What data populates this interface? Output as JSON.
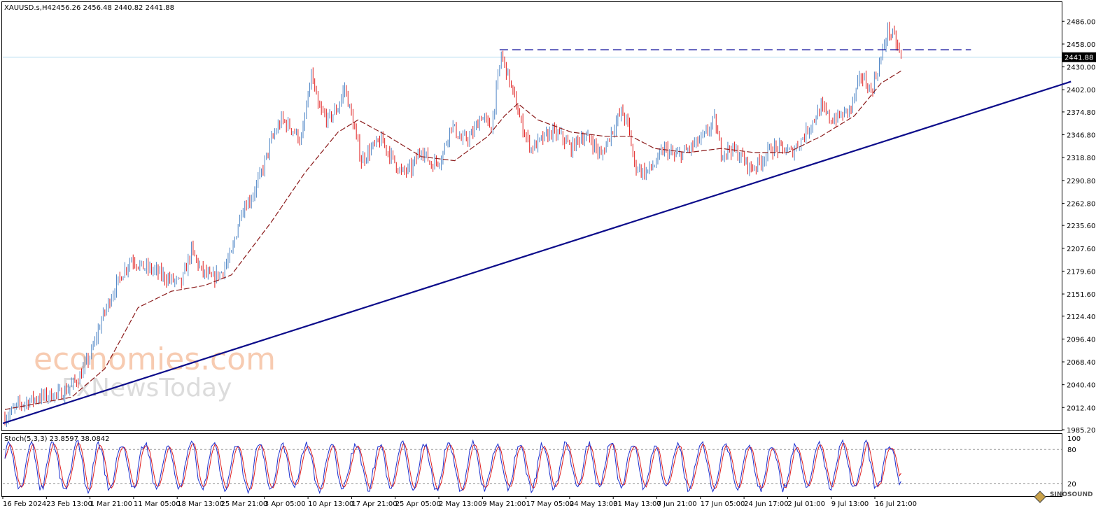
{
  "chart_data": {
    "type": "candlestick",
    "symbol_header": "XAUUSD.s,H4",
    "ohlc_header": "2456.26 2456.48 2440.82 2441.88",
    "ohlc": {
      "open": 2456.26,
      "high": 2456.48,
      "low": 2440.82,
      "close": 2441.88
    },
    "current_price_label": "2441.88",
    "current_price": 2441.88,
    "ylim": [
      1985.2,
      2500
    ],
    "y_ticks": [
      "2486.00",
      "2458.00",
      "2430.00",
      "2402.00",
      "2374.80",
      "2346.80",
      "2318.80",
      "2290.80",
      "2262.80",
      "2235.60",
      "2207.60",
      "2179.60",
      "2151.60",
      "2124.40",
      "2096.40",
      "2068.40",
      "2040.40",
      "2012.40",
      "1985.20"
    ],
    "x_ticks": [
      "16 Feb 2024",
      "23 Feb 13:00",
      "1 Mar 21:00",
      "11 Mar 05:00",
      "18 Mar 13:00",
      "25 Mar 21:00",
      "3 Apr 05:00",
      "10 Apr 13:00",
      "17 Apr 21:00",
      "25 Apr 05:00",
      "2 May 13:00",
      "9 May 21:00",
      "17 May 05:00",
      "24 May 13:00",
      "31 May 13:00",
      "7 Jun 21:00",
      "17 Jun 05:00",
      "24 Jun 17:00",
      "2 Jul 01:00",
      "9 Jul 13:00",
      "16 Jul 21:00"
    ],
    "bull_color": "#4f86c6",
    "bear_color": "#e02020",
    "price_path": [
      [
        0,
        2000
      ],
      [
        8,
        2015
      ],
      [
        20,
        2025
      ],
      [
        35,
        2030
      ],
      [
        45,
        2050
      ],
      [
        52,
        2080
      ],
      [
        58,
        2120
      ],
      [
        64,
        2150
      ],
      [
        70,
        2175
      ],
      [
        76,
        2195
      ],
      [
        82,
        2185
      ],
      [
        90,
        2180
      ],
      [
        98,
        2170
      ],
      [
        106,
        2165
      ],
      [
        112,
        2205
      ],
      [
        118,
        2180
      ],
      [
        124,
        2170
      ],
      [
        130,
        2178
      ],
      [
        136,
        2200
      ],
      [
        142,
        2255
      ],
      [
        148,
        2270
      ],
      [
        154,
        2300
      ],
      [
        160,
        2340
      ],
      [
        166,
        2365
      ],
      [
        172,
        2355
      ],
      [
        178,
        2340
      ],
      [
        184,
        2420
      ],
      [
        188,
        2380
      ],
      [
        194,
        2365
      ],
      [
        200,
        2380
      ],
      [
        204,
        2405
      ],
      [
        208,
        2370
      ],
      [
        214,
        2315
      ],
      [
        220,
        2330
      ],
      [
        226,
        2340
      ],
      [
        232,
        2320
      ],
      [
        238,
        2300
      ],
      [
        244,
        2305
      ],
      [
        250,
        2330
      ],
      [
        256,
        2310
      ],
      [
        262,
        2318
      ],
      [
        268,
        2360
      ],
      [
        274,
        2340
      ],
      [
        280,
        2345
      ],
      [
        286,
        2370
      ],
      [
        292,
        2355
      ],
      [
        298,
        2445
      ],
      [
        302,
        2420
      ],
      [
        306,
        2390
      ],
      [
        310,
        2360
      ],
      [
        316,
        2330
      ],
      [
        322,
        2340
      ],
      [
        328,
        2350
      ],
      [
        334,
        2345
      ],
      [
        340,
        2330
      ],
      [
        346,
        2345
      ],
      [
        352,
        2340
      ],
      [
        358,
        2320
      ],
      [
        364,
        2350
      ],
      [
        370,
        2375
      ],
      [
        374,
        2360
      ],
      [
        378,
        2310
      ],
      [
        384,
        2300
      ],
      [
        390,
        2310
      ],
      [
        396,
        2330
      ],
      [
        402,
        2320
      ],
      [
        408,
        2325
      ],
      [
        414,
        2335
      ],
      [
        420,
        2345
      ],
      [
        426,
        2365
      ],
      [
        430,
        2325
      ],
      [
        436,
        2330
      ],
      [
        442,
        2320
      ],
      [
        448,
        2305
      ],
      [
        454,
        2315
      ],
      [
        460,
        2330
      ],
      [
        466,
        2330
      ],
      [
        472,
        2325
      ],
      [
        478,
        2340
      ],
      [
        484,
        2360
      ],
      [
        490,
        2380
      ],
      [
        496,
        2365
      ],
      [
        502,
        2370
      ],
      [
        508,
        2380
      ],
      [
        514,
        2420
      ],
      [
        520,
        2400
      ],
      [
        526,
        2440
      ],
      [
        530,
        2475
      ],
      [
        534,
        2465
      ],
      [
        538,
        2442
      ]
    ],
    "ema_path": [
      [
        0,
        2010
      ],
      [
        40,
        2025
      ],
      [
        60,
        2060
      ],
      [
        80,
        2135
      ],
      [
        100,
        2155
      ],
      [
        120,
        2162
      ],
      [
        136,
        2175
      ],
      [
        160,
        2240
      ],
      [
        180,
        2300
      ],
      [
        200,
        2350
      ],
      [
        212,
        2365
      ],
      [
        230,
        2345
      ],
      [
        250,
        2320
      ],
      [
        270,
        2315
      ],
      [
        290,
        2345
      ],
      [
        300,
        2370
      ],
      [
        308,
        2385
      ],
      [
        320,
        2365
      ],
      [
        340,
        2350
      ],
      [
        360,
        2345
      ],
      [
        376,
        2345
      ],
      [
        390,
        2330
      ],
      [
        410,
        2325
      ],
      [
        430,
        2330
      ],
      [
        450,
        2325
      ],
      [
        470,
        2325
      ],
      [
        490,
        2345
      ],
      [
        510,
        2370
      ],
      [
        526,
        2410
      ],
      [
        538,
        2425
      ]
    ],
    "trendline": {
      "start": [
        0,
        1993
      ],
      "end": [
        640,
        2412
      ]
    },
    "resistance": {
      "price": 2451,
      "from": 297,
      "to": 580
    },
    "stochastic": {
      "label": "Stoch(5,3,3) 23.8597 38.0842",
      "main": 23.8597,
      "signal": 38.0842,
      "levels": [
        80,
        20
      ],
      "scale_labels": [
        "100",
        "80",
        "20"
      ],
      "main_color": "#1b2fd0",
      "signal_color": "#e02020"
    },
    "watermark": {
      "line1": "economies.com",
      "line2": "FxNewsToday"
    },
    "badge": {
      "text": "SINOSOUND"
    }
  }
}
